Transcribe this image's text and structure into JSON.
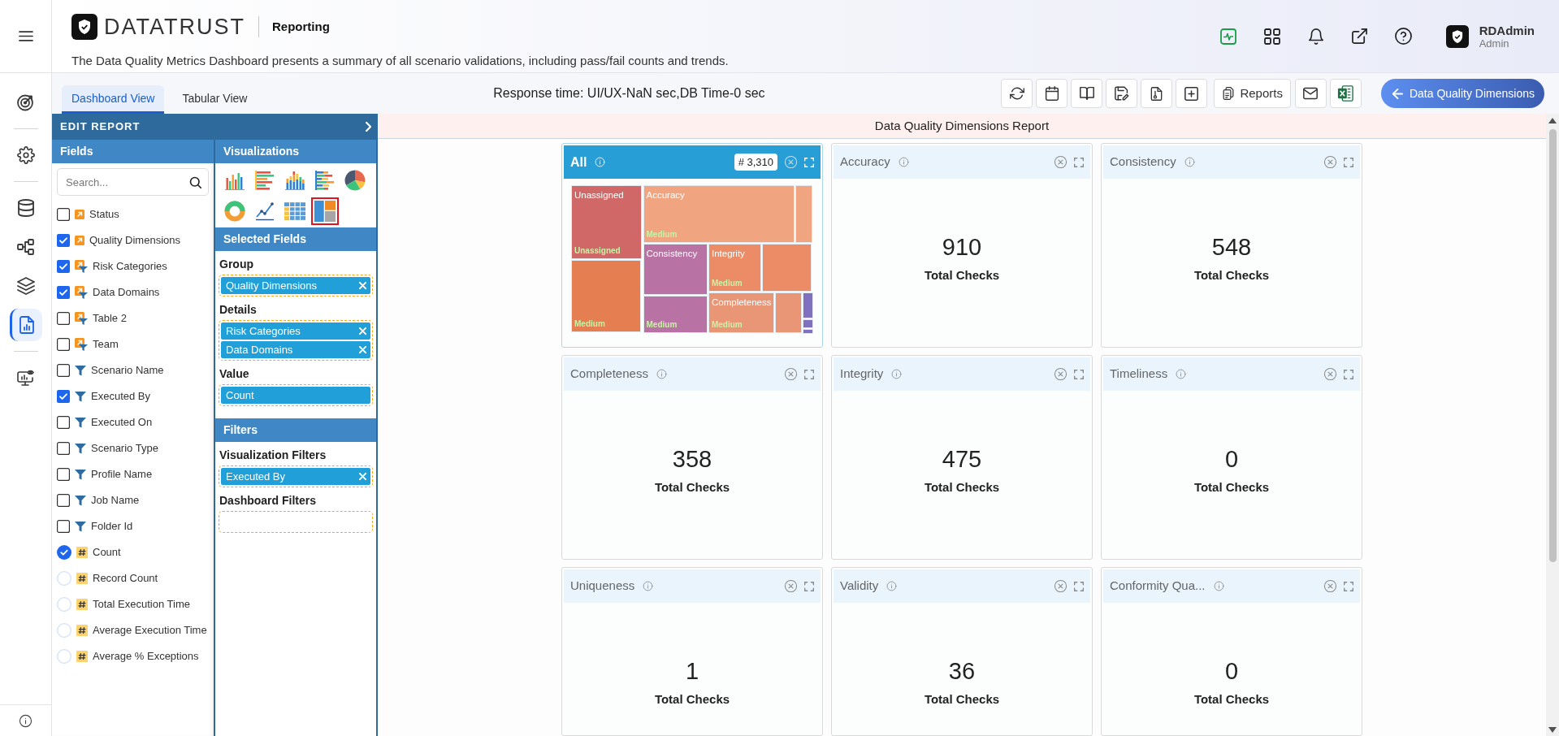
{
  "nav_rail": {
    "groups": [
      {
        "items": [
          {
            "kind": "target",
            "selected": false
          }
        ]
      },
      {
        "items": [
          {
            "kind": "settings",
            "selected": false
          }
        ]
      },
      {
        "items": [
          {
            "kind": "database",
            "selected": false
          },
          {
            "kind": "nodes",
            "selected": false
          },
          {
            "kind": "layers",
            "selected": false
          },
          {
            "kind": "report",
            "selected": true
          }
        ]
      },
      {
        "items": [
          {
            "kind": "monitor",
            "selected": false
          }
        ]
      }
    ]
  },
  "header": {
    "brand": "DATATRUST",
    "module": "Reporting",
    "description": "The Data Quality Metrics Dashboard presents a summary of all scenario validations, including pass/fail counts and trends.",
    "icons": [
      {
        "kind": "activity"
      },
      {
        "kind": "apps"
      },
      {
        "kind": "notifications"
      },
      {
        "kind": "open-external"
      },
      {
        "kind": "help"
      }
    ],
    "user": {
      "name": "RDAdmin",
      "role": "Admin"
    }
  },
  "tabs": [
    {
      "label": "Dashboard View",
      "selected": true
    },
    {
      "label": "Tabular View",
      "selected": false
    }
  ],
  "response_time": "Response time: UI/UX-NaN sec,DB Time-0 sec",
  "toolbar": [
    {
      "kind": "refresh"
    },
    {
      "kind": "calendar"
    },
    {
      "kind": "book"
    },
    {
      "kind": "save-edit"
    },
    {
      "kind": "document"
    },
    {
      "kind": "add"
    },
    {
      "kind": "reports",
      "label": "Reports"
    },
    {
      "kind": "mail"
    },
    {
      "kind": "spreadsheet"
    }
  ],
  "back_button": "Data Quality Dimensions",
  "edit_report": {
    "title": "EDIT REPORT",
    "fields_title": "Fields",
    "search": {
      "placeholder": "Search..."
    },
    "fields": [
      {
        "label": "Status",
        "kind": "dimension",
        "checked": false
      },
      {
        "label": "Quality Dimensions",
        "kind": "dimension",
        "checked": true
      },
      {
        "label": "Risk Categories",
        "kind": "hierarchy",
        "checked": true
      },
      {
        "label": "Data Domains",
        "kind": "hierarchy",
        "checked": true
      },
      {
        "label": "Table 2",
        "kind": "hierarchy",
        "checked": false
      },
      {
        "label": "Team",
        "kind": "hierarchy",
        "checked": false
      },
      {
        "label": "Scenario Name",
        "kind": "filter",
        "checked": false
      },
      {
        "label": "Executed By",
        "kind": "filter",
        "checked": true
      },
      {
        "label": "Executed On",
        "kind": "filter",
        "checked": false
      },
      {
        "label": "Scenario Type",
        "kind": "filter",
        "checked": false
      },
      {
        "label": "Profile Name",
        "kind": "filter",
        "checked": false
      },
      {
        "label": "Job Name",
        "kind": "filter",
        "checked": false
      },
      {
        "label": "Folder Id",
        "kind": "filter",
        "checked": false
      },
      {
        "label": "Count",
        "kind": "measure",
        "selected": true
      },
      {
        "label": "Record Count",
        "kind": "measure",
        "selected": false
      },
      {
        "label": "Total Execution Time",
        "kind": "measure",
        "selected": false
      },
      {
        "label": "Average Execution Time",
        "kind": "measure",
        "selected": false
      },
      {
        "label": "Average % Exceptions",
        "kind": "measure",
        "selected": false
      }
    ],
    "visualizations_title": "Visualizations",
    "visualizations": [
      {
        "kind": "bar",
        "selected": false
      },
      {
        "kind": "horizontal-bar",
        "selected": false
      },
      {
        "kind": "stacked-bar",
        "selected": false
      },
      {
        "kind": "stacked-horizontal-bar",
        "selected": false
      },
      {
        "kind": "pie",
        "selected": false
      },
      {
        "kind": "donut",
        "selected": false
      },
      {
        "kind": "line",
        "selected": false
      },
      {
        "kind": "table",
        "selected": false
      },
      {
        "kind": "treemap",
        "selected": true
      }
    ],
    "selected_fields_title": "Selected Fields",
    "selected_groups": [
      {
        "label": "Group",
        "chips": [
          {
            "label": "Quality Dimensions",
            "removable": true
          }
        ]
      },
      {
        "label": "Details",
        "chips": [
          {
            "label": "Risk Categories",
            "removable": true
          },
          {
            "label": "Data Domains",
            "removable": true
          }
        ]
      },
      {
        "label": "Value",
        "chips": [
          {
            "label": "Count",
            "removable": false
          }
        ]
      }
    ],
    "filters_title": "Filters",
    "filter_groups": [
      {
        "label": "Visualization Filters",
        "chips": [
          {
            "label": "Executed By",
            "removable": true
          }
        ]
      },
      {
        "label": "Dashboard Filters"
      }
    ]
  },
  "report": {
    "title": "Data Quality Dimensions Report",
    "cards": [
      {
        "kind": "treemap",
        "title": "All",
        "badge": "# 3,310",
        "tiles": [
          {
            "title": "Unassigned",
            "subtitle": "Unassigned",
            "color": "#d06868"
          },
          {
            "subtitle": "Medium",
            "color": "#e57e50"
          },
          {
            "title": "Accuracy",
            "subtitle": "Medium",
            "color": "#f0a580"
          },
          {
            "color": "#f0a580"
          },
          {
            "title": "Consistency",
            "color": "#b872a4"
          },
          {
            "subtitle": "Medium",
            "color": "#b872a4"
          },
          {
            "title": "Integrity",
            "subtitle": "Medium",
            "color": "#ec8c67"
          },
          {
            "color": "#ec8c67"
          },
          {
            "title": "Completeness",
            "subtitle": "Medium",
            "color": "#e99676"
          },
          {
            "color": "#e99676"
          },
          {
            "color": "#8070c0"
          },
          {
            "color": "#8070c0"
          },
          {
            "color": "#8070c0"
          }
        ]
      },
      {
        "kind": "metric",
        "title": "Accuracy",
        "value": "910",
        "caption": "Total Checks"
      },
      {
        "kind": "metric",
        "title": "Consistency",
        "value": "548",
        "caption": "Total Checks"
      },
      {
        "kind": "metric",
        "title": "Completeness",
        "value": "358",
        "caption": "Total Checks"
      },
      {
        "kind": "metric",
        "title": "Integrity",
        "value": "475",
        "caption": "Total Checks"
      },
      {
        "kind": "metric",
        "title": "Timeliness",
        "value": "0",
        "caption": "Total Checks"
      },
      {
        "kind": "metric",
        "title": "Uniqueness",
        "value": "1",
        "caption": "Total Checks"
      },
      {
        "kind": "metric",
        "title": "Validity",
        "value": "36",
        "caption": "Total Checks"
      },
      {
        "kind": "metric",
        "title": "Conformity Qua...",
        "value": "0",
        "caption": "Total Checks"
      }
    ]
  }
}
